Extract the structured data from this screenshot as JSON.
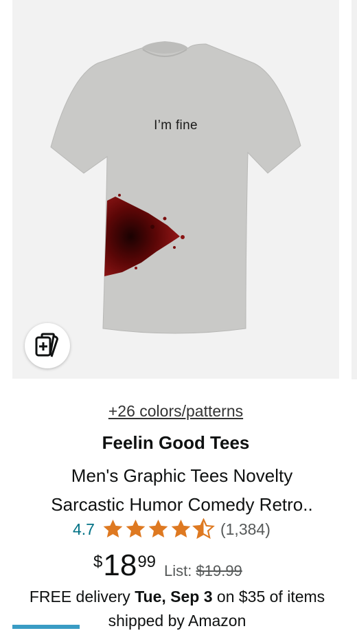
{
  "product": {
    "colors_link": "+26 colors/patterns",
    "brand": "Feelin Good Tees",
    "title_line1": "Men's Graphic Tees Novelty",
    "title_line2": "Sarcastic Humor Comedy Retro..",
    "shirt_print": "I’m fine",
    "rating": "4.7",
    "rating_value": 4.7,
    "rating_max": 5,
    "review_count": "(1,384)",
    "price": {
      "symbol": "$",
      "whole": "18",
      "fraction": "99",
      "list_label": "List:",
      "list_value": "$19.99"
    },
    "delivery": {
      "prefix": "FREE delivery ",
      "date": "Tue, Sep 3",
      "suffix": " on $35 of items shipped by Amazon"
    }
  },
  "icons": {
    "compare": "compare-cards-icon",
    "star": "star-icon"
  },
  "colors": {
    "link_teal": "#007185",
    "star_orange": "#de7921",
    "text": "#0f1111",
    "secondary_text": "#565959",
    "image_bg": "#f2f2f2",
    "shirt_gray": "#c9c9c7",
    "stain_red": "#7a0d0d"
  }
}
